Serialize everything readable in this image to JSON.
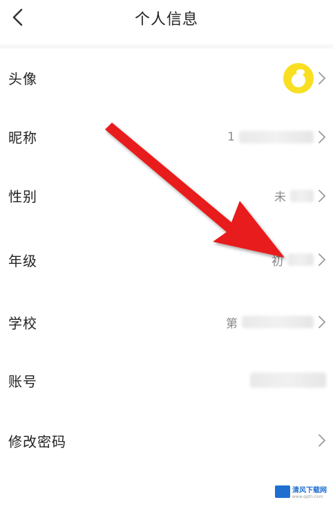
{
  "header": {
    "title": "个人信息"
  },
  "rows": [
    {
      "label": "头像",
      "value": ""
    },
    {
      "label": "昵称",
      "value": "1"
    },
    {
      "label": "性别",
      "value": "未"
    },
    {
      "label": "年级",
      "value": "初"
    },
    {
      "label": "学校",
      "value": "第"
    },
    {
      "label": "账号",
      "value": ""
    },
    {
      "label": "修改密码",
      "value": ""
    }
  ],
  "colors": {
    "annotation_arrow": "#e81f1f",
    "avatar_bg": "#f8df22"
  },
  "icons": {
    "back": "chevron-left-icon",
    "row_arrow": "chevron-right-icon"
  },
  "watermark": {
    "text": "清风下载网",
    "sub": "www.qqtn.com"
  }
}
